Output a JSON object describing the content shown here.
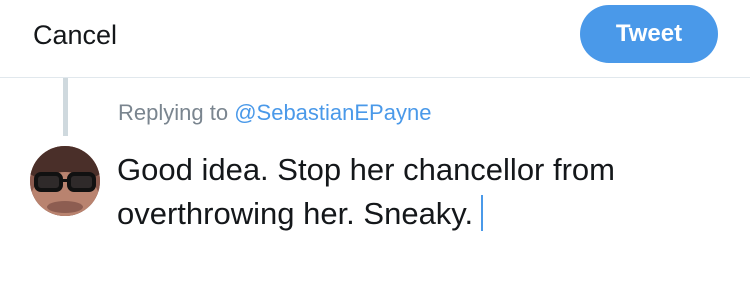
{
  "header": {
    "cancel_label": "Cancel",
    "tweet_label": "Tweet"
  },
  "reply": {
    "replying_prefix": "Replying to",
    "mention": "@SebastianEPayne"
  },
  "composer": {
    "text": "Good idea. Stop her chancellor from overthrowing her. Sneaky."
  },
  "colors": {
    "accent": "#4a99e9",
    "text": "#14171a",
    "muted": "#7a858f"
  }
}
